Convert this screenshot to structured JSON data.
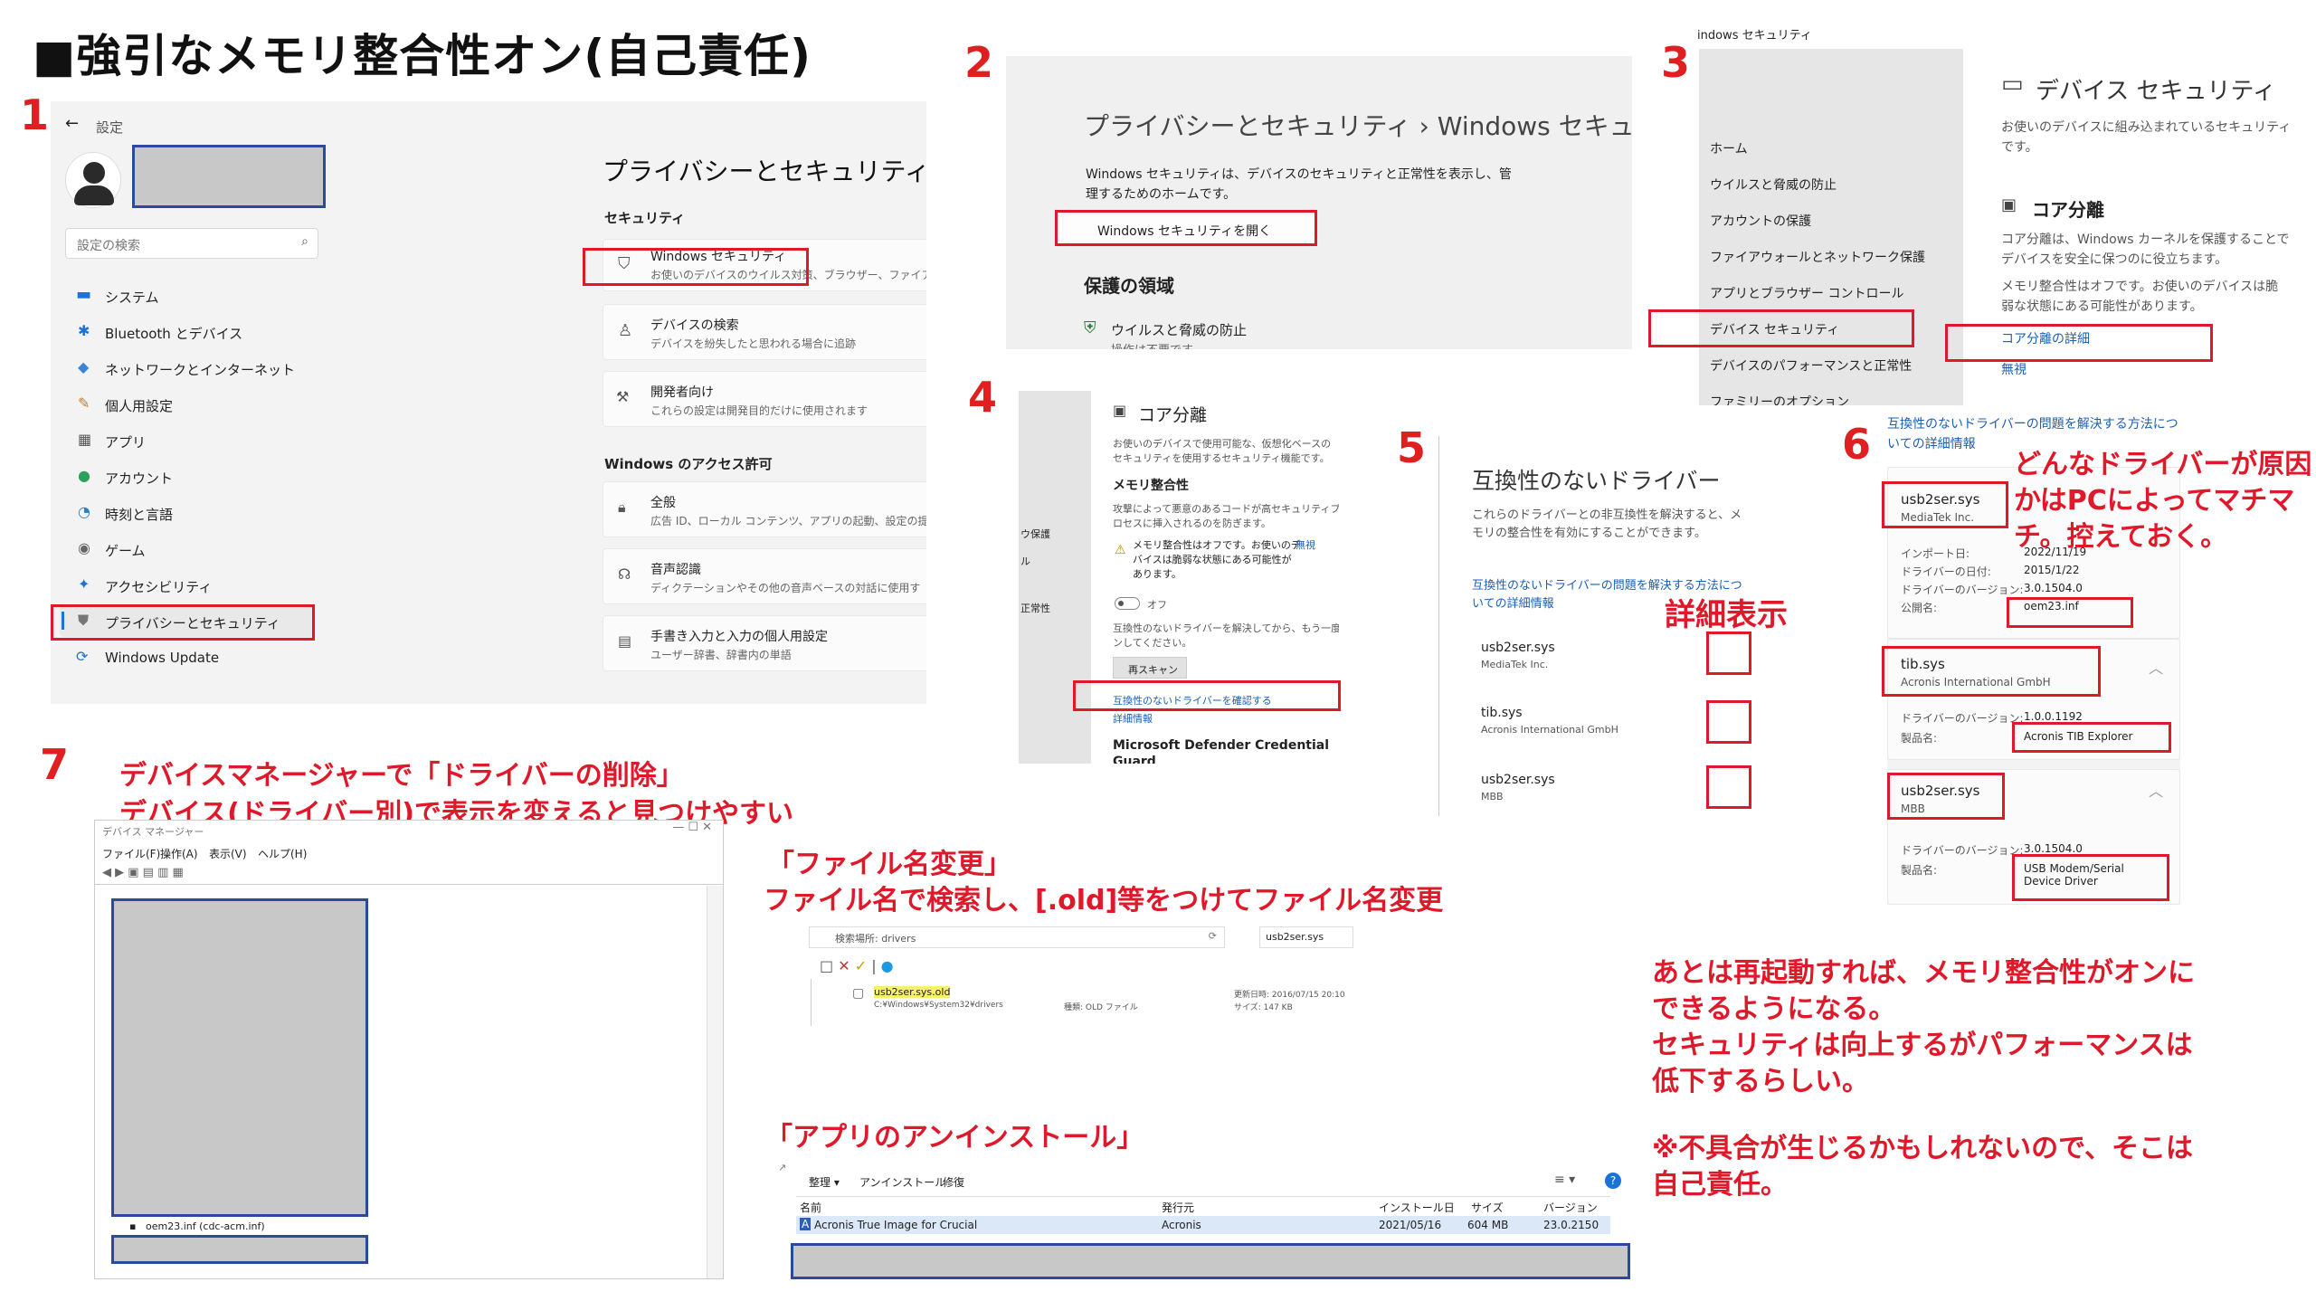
{
  "title": "■強引なメモリ整合性オン(自己責任)",
  "steps": {
    "s1": "1",
    "s2": "2",
    "s3": "3",
    "s4": "4",
    "s5": "5",
    "s6": "6",
    "s7": "7"
  },
  "panel1": {
    "back": "←",
    "settings": "設定",
    "search_placeholder": "設定の検索",
    "nav": [
      {
        "label": "システム"
      },
      {
        "label": "Bluetooth とデバイス"
      },
      {
        "label": "ネットワークとインターネット"
      },
      {
        "label": "個人用設定"
      },
      {
        "label": "アプリ"
      },
      {
        "label": "アカウント"
      },
      {
        "label": "時刻と言語"
      },
      {
        "label": "ゲーム"
      },
      {
        "label": "アクセシビリティ"
      },
      {
        "label": "プライバシーとセキュリティ"
      },
      {
        "label": "Windows Update"
      }
    ],
    "heading": "プライバシーとセキュリティ",
    "section_security": "セキュリティ",
    "items": [
      {
        "title": "Windows セキュリティ",
        "desc": "お使いのデバイスのウイルス対策、ブラウザー、ファイアウ"
      },
      {
        "title": "デバイスの検索",
        "desc": "デバイスを紛失したと思われる場合に追跡"
      },
      {
        "title": "開発者向け",
        "desc": "これらの設定は開発目的だけに使用されます"
      }
    ],
    "section_access": "Windows のアクセス許可",
    "items2": [
      {
        "title": "全般",
        "desc": "広告 ID、ローカル コンテンツ、アプリの起動、設定の提"
      },
      {
        "title": "音声認識",
        "desc": "ディクテーションやその他の音声ベースの対話に使用す"
      },
      {
        "title": "手書き入力と入力の個人用設定",
        "desc": "ユーザー辞書、辞書内の単語"
      }
    ]
  },
  "panel2": {
    "breadcrumb": "プライバシーとセキュリティ  ›  Windows セキュリティ",
    "desc1": "Windows セキュリティは、デバイスのセキュリティと正常性を表示し、管",
    "desc2": "理するためのホームです。",
    "open_button": "Windows セキュリティを開く",
    "protect_heading": "保護の領域",
    "virus": "ウイルスと脅威の防止",
    "virus_sub": "操作は不要です。"
  },
  "panel3": {
    "window_title": "indows セキュリティ",
    "nav": [
      {
        "label": "ホーム"
      },
      {
        "label": "ウイルスと脅威の防止"
      },
      {
        "label": "アカウントの保護"
      },
      {
        "label": "ファイアウォールとネットワーク保護"
      },
      {
        "label": "アプリとブラウザー コントロール"
      },
      {
        "label": "デバイス セキュリティ"
      },
      {
        "label": "デバイスのパフォーマンスと正常性"
      },
      {
        "label": "ファミリーのオプション"
      }
    ],
    "heading": "デバイス セキュリティ",
    "desc1": "お使いのデバイスに組み込まれているセキュリティ",
    "desc2": "です。",
    "core": "コア分離",
    "core_desc1": "コア分離は、Windows カーネルを保護することで",
    "core_desc2": "デバイスを安全に保つのに役立ちます。",
    "core_desc3": "メモリ整合性はオフです。お使いのデバイスは脆",
    "core_desc4": "弱な状態にある可能性があります。",
    "core_link": "コア分離の詳細",
    "ignore": "無視"
  },
  "panel4": {
    "heading": "コア分離",
    "desc1": "お使いのデバイスで使用可能な、仮想化ベースの",
    "desc2": "セキュリティを使用するセキュリティ機能です。",
    "mem": "メモリ整合性",
    "mem_desc1": "攻撃によって悪意のあるコードが高セキュリティプ",
    "mem_desc2": "ロセスに挿入されるのを防ぎます。",
    "warn1": "メモリ整合性はオフです。お使いのデ",
    "warn2": "バイスは脆弱な状態にある可能性が",
    "warn3": "あります。",
    "ignore": "無視",
    "toggle": "オフ",
    "incompat1": "互換性のないドライバーを解決してから、もう一度スキャ",
    "incompat2": "ンしてください。",
    "rescan": "再スキャン",
    "check_link": "互換性のないドライバーを確認する",
    "detail_link": "詳細情報",
    "defender": "Microsoft Defender Credential",
    "defender2": "Guard",
    "left_labels": [
      "ウ保護",
      "ル",
      "正常性"
    ]
  },
  "panel5": {
    "heading": "互換性のないドライバー",
    "desc1": "これらのドライバーとの非互換性を解決すると、メ",
    "desc2": "モリの整合性を有効にすることができます。",
    "link1": "互換性のないドライバーの問題を解決する方法につ",
    "link2": "いての詳細情報",
    "drivers": [
      {
        "name": "usb2ser.sys",
        "vendor": "MediaTek Inc."
      },
      {
        "name": "tib.sys",
        "vendor": "Acronis International GmbH"
      },
      {
        "name": "usb2ser.sys",
        "vendor": "MBB"
      }
    ],
    "detail_label": "詳細表示"
  },
  "panel6": {
    "top_link1": "互換性のないドライバーの問題を解決する方法につ",
    "top_link2": "いての詳細情報",
    "note": "どんなドライバーが原因かはPCによってマチマチ。控えておく。",
    "card1": {
      "name": "usb2ser.sys",
      "vendor": "MediaTek Inc.",
      "rows": [
        {
          "k": "インポート日:",
          "v": "2022/11/19"
        },
        {
          "k": "ドライバーの日付:",
          "v": "2015/1/22"
        },
        {
          "k": "ドライバーのバージョン:",
          "v": "3.0.1504.0"
        },
        {
          "k": "公開名:",
          "v": "oem23.inf"
        }
      ]
    },
    "card2": {
      "name": "tib.sys",
      "vendor": "Acronis International GmbH",
      "rows": [
        {
          "k": "ドライバーのバージョン:",
          "v": "1.0.0.1192"
        },
        {
          "k": "製品名:",
          "v": "Acronis TIB Explorer"
        }
      ]
    },
    "card3": {
      "name": "usb2ser.sys",
      "vendor": "MBB",
      "rows": [
        {
          "k": "ドライバーのバージョン:",
          "v": "3.0.1504.0"
        },
        {
          "k": "製品名:",
          "v": "USB Modem/Serial Device Driver"
        }
      ]
    }
  },
  "panel7": {
    "note1": "デバイスマネージャーで「ドライバーの削除」",
    "note2": "デバイス(ドライバー別)で表示を変えると見つけやすい",
    "window_title": "デバイス マネージャー",
    "menu": [
      {
        "label": "ファイル(F)"
      },
      {
        "label": "操作(A)"
      },
      {
        "label": "表示(V)"
      },
      {
        "label": "ヘルプ(H)"
      }
    ],
    "item": "oem23.inf (cdc-acm.inf)"
  },
  "rename": {
    "title": "「ファイル名変更」",
    "desc": "ファイル名で検索し、[.old]等をつけてファイル名変更",
    "location": "検索場所: drivers",
    "search": "usb2ser.sys",
    "file": "usb2ser.sys.old",
    "path": "C:¥Windows¥System32¥drivers",
    "modified": "更新日時: 2016/07/15 20:10",
    "type": "種類: OLD ファイル",
    "size": "サイズ: 147 KB"
  },
  "uninstall": {
    "title": "「アプリのアンインストール」",
    "toolbar": [
      "整理 ▾",
      "アンインストール",
      "修復"
    ],
    "columns": [
      "名前",
      "発行元",
      "インストール日",
      "サイズ",
      "バージョン"
    ],
    "row": [
      "Acronis True Image for Crucial",
      "Acronis",
      "2021/05/16",
      "604 MB",
      "23.0.2150"
    ]
  },
  "final": {
    "l1": "あとは再起動すれば、メモリ整合性がオンに",
    "l2": "できるようになる。",
    "l3": "セキュリティは向上するがパフォーマンスは",
    "l4": "低下するらしい。",
    "l5": "※不具合が生じるかもしれないので、そこは",
    "l6": "自己責任。"
  },
  "colors": {
    "accent_red": "#e0192a",
    "accent_blue": "#2b4a9c",
    "link": "#1a5fb4"
  }
}
